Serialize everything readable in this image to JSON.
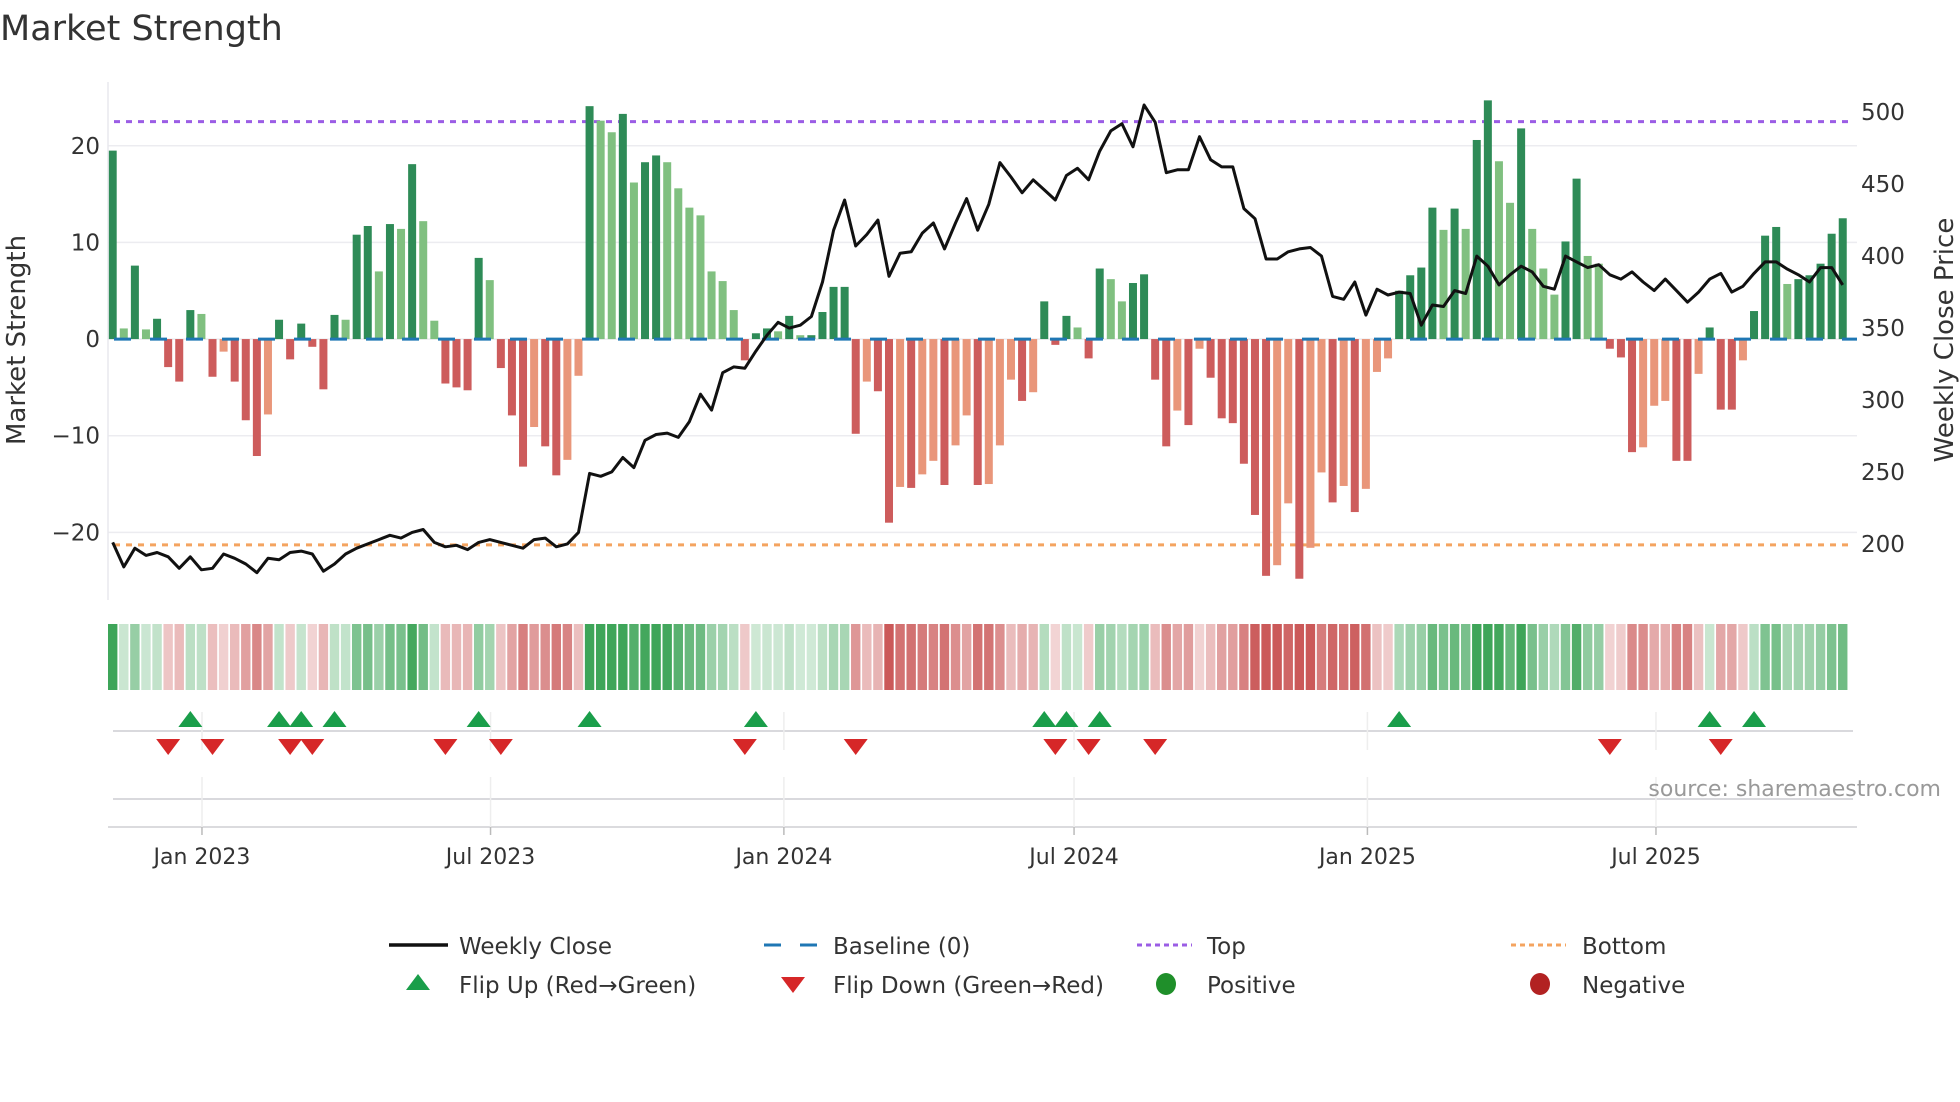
{
  "chart_data": {
    "type": "bar",
    "title": "Market Strength",
    "ylabel": "Market Strength",
    "y2label": "Weekly Close Price",
    "source": "source: sharemaestro.com",
    "ylim": [
      -27,
      26.6
    ],
    "y2lim": [
      161,
      521
    ],
    "yticks": [
      -20,
      -10,
      0,
      10,
      20
    ],
    "yticklabels": [
      "−20",
      "−10",
      "0",
      "10",
      "20"
    ],
    "y2ticks": [
      200,
      250,
      300,
      350,
      400,
      450,
      500
    ],
    "y2ticklabels": [
      "200",
      "250",
      "300",
      "350",
      "400",
      "450",
      "500"
    ],
    "top_level": 22.5,
    "bottom_level": -21.3,
    "x_start_date": "2022-11-06",
    "xticks": [
      {
        "date": "2023-01-01",
        "label": "Jan 2023"
      },
      {
        "date": "2023-07-01",
        "label": "Jul 2023"
      },
      {
        "date": "2024-01-01",
        "label": "Jan 2024"
      },
      {
        "date": "2024-07-01",
        "label": "Jul 2024"
      },
      {
        "date": "2025-01-01",
        "label": "Jan 2025"
      },
      {
        "date": "2025-07-01",
        "label": "Jul 2025"
      }
    ],
    "strength": [
      19.5,
      1.1,
      7.6,
      1.0,
      2.1,
      -2.9,
      -4.4,
      3.0,
      2.6,
      -3.9,
      -1.3,
      -4.4,
      -8.4,
      -12.1,
      -7.8,
      2.0,
      -2.1,
      1.6,
      -0.8,
      -5.2,
      2.5,
      2.0,
      10.8,
      11.7,
      7.0,
      11.9,
      11.4,
      18.1,
      12.2,
      1.9,
      -4.6,
      -5.0,
      -5.3,
      8.4,
      6.1,
      -3.0,
      -7.9,
      -13.2,
      -9.1,
      -11.1,
      -14.1,
      -12.5,
      -3.8,
      24.1,
      22.6,
      21.4,
      23.3,
      16.2,
      18.3,
      19.0,
      18.3,
      15.6,
      13.6,
      12.8,
      7.0,
      6.0,
      3.0,
      -2.2,
      0.6,
      1.1,
      0.8,
      2.4,
      0.4,
      0.4,
      2.8,
      5.4,
      5.4,
      -9.8,
      -4.4,
      -5.4,
      -19.0,
      -15.3,
      -15.4,
      -14.0,
      -12.6,
      -15.1,
      -11.0,
      -7.9,
      -15.1,
      -15.0,
      -11.0,
      -4.2,
      -6.4,
      -5.5,
      3.9,
      -0.6,
      2.4,
      1.2,
      -2.0,
      7.3,
      6.2,
      3.9,
      5.8,
      6.7,
      -4.2,
      -11.1,
      -7.4,
      -8.9,
      -1.0,
      -4.0,
      -8.2,
      -8.7,
      -12.9,
      -18.2,
      -24.5,
      -23.4,
      -17.0,
      -24.8,
      -21.6,
      -13.8,
      -16.9,
      -15.2,
      -17.9,
      -15.5,
      -3.4,
      -2.0,
      5.0,
      6.6,
      7.4,
      13.6,
      11.3,
      13.5,
      11.4,
      20.6,
      24.7,
      18.4,
      14.1,
      21.8,
      11.4,
      7.3,
      4.6,
      10.1,
      16.6,
      8.6,
      7.8,
      -1.0,
      -1.9,
      -11.7,
      -11.2,
      -6.9,
      -6.4,
      -12.6,
      -12.6,
      -3.6,
      1.2,
      -7.3,
      -7.3,
      -2.2,
      2.9,
      10.7,
      11.6,
      5.7,
      6.2,
      6.6,
      7.8,
      10.9,
      12.5
    ],
    "weekly_close": [
      201,
      184,
      197,
      192,
      194,
      191,
      183,
      191,
      182,
      183,
      193,
      190,
      186,
      180,
      190,
      189,
      194,
      195,
      193,
      181,
      186,
      193,
      197,
      200,
      203,
      206,
      204,
      208,
      210,
      201,
      198,
      199,
      196,
      201,
      203,
      201,
      199,
      197,
      203,
      204,
      198,
      200,
      208,
      249,
      247,
      250,
      260,
      253,
      272,
      276,
      277,
      274,
      285,
      304,
      293,
      319,
      323,
      322,
      334,
      345,
      354,
      350,
      352,
      358,
      382,
      418,
      439,
      407,
      415,
      425,
      386,
      402,
      403,
      416,
      423,
      405,
      423,
      440,
      418,
      436,
      465,
      455,
      444,
      453,
      446,
      439,
      456,
      461,
      453,
      473,
      487,
      492,
      476,
      505,
      493,
      458,
      460,
      460,
      483,
      467,
      462,
      462,
      433,
      426,
      398,
      398,
      403,
      405,
      406,
      400,
      372,
      370,
      382,
      359,
      377,
      373,
      375,
      374,
      352,
      366,
      365,
      376,
      374,
      400,
      393,
      380,
      387,
      393,
      389,
      379,
      377,
      400,
      396,
      392,
      394,
      387,
      384,
      389,
      382,
      376,
      384,
      376,
      368,
      375,
      384,
      388,
      375,
      379,
      388,
      396,
      396,
      391,
      387,
      382,
      392,
      392,
      380
    ],
    "flip_up_weeks": [
      8,
      16,
      18,
      21,
      34,
      44,
      59,
      85,
      87,
      90,
      117,
      145,
      149
    ],
    "flip_down_weeks": [
      6,
      10,
      17,
      19,
      31,
      36,
      58,
      68,
      86,
      89,
      95,
      136,
      146
    ],
    "colors": {
      "strong_pos": "#2e8b57",
      "weak_pos": "#80c080",
      "strong_neg": "#cd5c5c",
      "weak_neg": "#e9967a",
      "line": "#111111",
      "baseline": "#1f77b4",
      "top": "#9b5de5",
      "bottom": "#f4a460",
      "flip_up": "#1a9e4a",
      "flip_down": "#d62728",
      "positive": "#1f8f2a",
      "negative": "#b22222"
    },
    "legend": {
      "placement": "bottom",
      "items": [
        {
          "label": "Weekly Close",
          "kind": "line"
        },
        {
          "label": "Baseline (0)",
          "kind": "baseline"
        },
        {
          "label": "Top",
          "kind": "top"
        },
        {
          "label": "Bottom",
          "kind": "bottom"
        },
        {
          "label": "Flip Up (Red→Green)",
          "kind": "up"
        },
        {
          "label": "Flip Down (Green→Red)",
          "kind": "down"
        },
        {
          "label": "Positive",
          "kind": "pos"
        },
        {
          "label": "Negative",
          "kind": "neg"
        }
      ]
    }
  }
}
